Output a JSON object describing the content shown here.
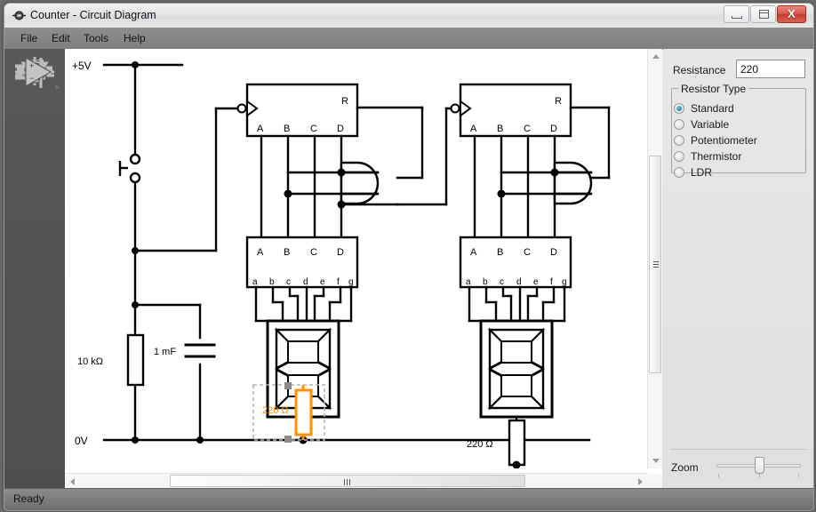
{
  "window": {
    "title": "Counter - Circuit Diagram",
    "app_icon": "circuit-app-icon",
    "buttons": {
      "minimize": "minimize-button",
      "maximize": "maximize-button",
      "close_glyph": "X"
    }
  },
  "menu": {
    "items": [
      {
        "label": "File",
        "name": "menu-file"
      },
      {
        "label": "Edit",
        "name": "menu-edit"
      },
      {
        "label": "Tools",
        "name": "menu-tools"
      },
      {
        "label": "Help",
        "name": "menu-help"
      }
    ]
  },
  "toolbar": {
    "tools": [
      {
        "name": "select-tool",
        "icon": "cursor-arrow-icon",
        "has_flyout": false
      },
      {
        "name": "wire-tool",
        "icon": "wire-icon",
        "has_flyout": false
      },
      {
        "name": "resistor-tool",
        "icon": "resistor-icon",
        "has_flyout": true
      },
      {
        "name": "capacitor-tool",
        "icon": "capacitor-icon",
        "has_flyout": true
      },
      {
        "name": "ground-tool",
        "icon": "ground-icon",
        "has_flyout": true
      },
      {
        "name": "switch-tool",
        "icon": "switch-icon",
        "has_flyout": true
      },
      {
        "name": "logic-gate-tool",
        "icon": "and-gate-icon",
        "has_flyout": true
      },
      {
        "name": "diode-tool",
        "icon": "diode-icon",
        "has_flyout": true
      },
      {
        "name": "transistor-tool",
        "icon": "transistor-icon",
        "has_flyout": true
      },
      {
        "name": "opamp-tool",
        "icon": "opamp-icon",
        "has_flyout": false
      }
    ]
  },
  "properties": {
    "resistance_label": "Resistance",
    "resistance_value": "220",
    "resistor_type_legend": "Resistor Type",
    "resistor_types": [
      {
        "label": "Standard",
        "selected": true
      },
      {
        "label": "Variable",
        "selected": false
      },
      {
        "label": "Potentiometer",
        "selected": false
      },
      {
        "label": "Thermistor",
        "selected": false
      },
      {
        "label": "LDR",
        "selected": false
      }
    ],
    "zoom_label": "Zoom",
    "zoom_value": 50
  },
  "statusbar": {
    "text": "Ready"
  },
  "canvas": {
    "selection_color": "#FF9100",
    "wire_color": "#000000",
    "labels": {
      "rail_positive": "+5V",
      "rail_ground": "0V",
      "pullup_resistor": "10 kΩ",
      "timing_capacitor": "1 mF",
      "resistor_selected": "220 Ω",
      "resistor_second": "220 Ω"
    },
    "counter_pins": {
      "outputs": [
        "A",
        "B",
        "C",
        "D"
      ],
      "reset": "R"
    },
    "decoder_pins": {
      "inputs": [
        "A",
        "B",
        "C",
        "D"
      ],
      "segments": [
        "a",
        "b",
        "c",
        "d",
        "e",
        "f",
        "g"
      ]
    },
    "selected_component": "resistor-220-ohm"
  }
}
